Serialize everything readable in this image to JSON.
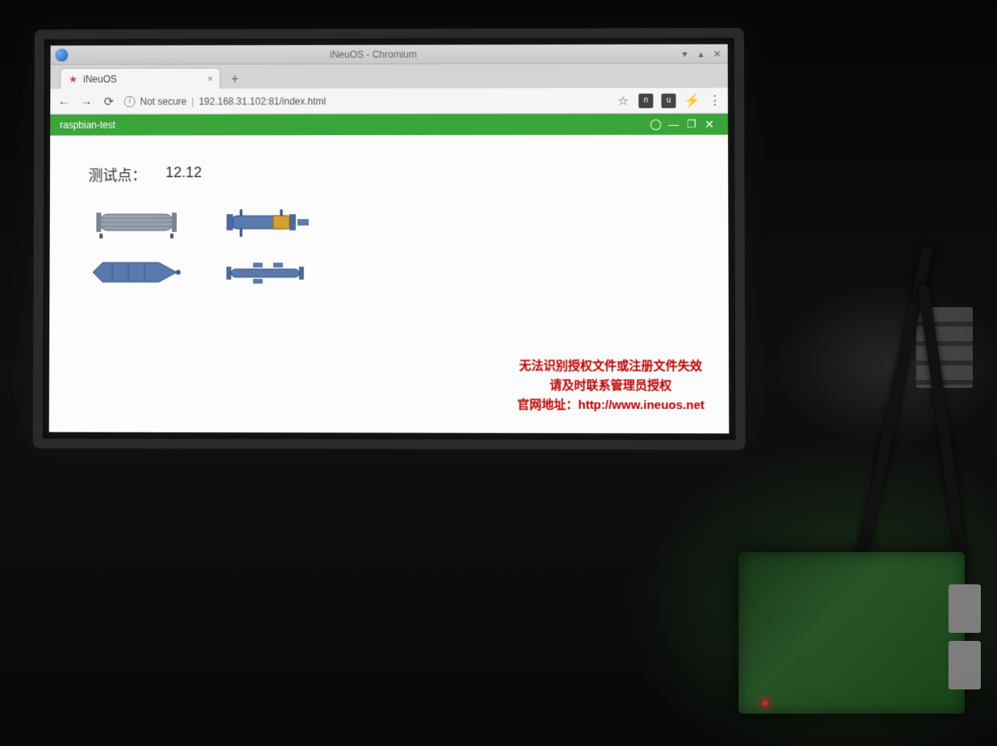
{
  "os_window": {
    "title": "iNeuOS - Chromium"
  },
  "browser": {
    "tab": {
      "label": "iNeuOS"
    },
    "security_label": "Not secure",
    "url": "192.168.31.102:81/index.html"
  },
  "appbar": {
    "title": "raspbian-test"
  },
  "page": {
    "testpoint_label": "测试点：",
    "testpoint_value": "12.12"
  },
  "license": {
    "line1": "无法识别授权文件或注册文件失效",
    "line2": "请及时联系管理员授权",
    "line3_prefix": "官网地址：",
    "line3_url": "http://www.ineuos.net"
  },
  "colors": {
    "appbar_bg": "#3aa63a",
    "error_text": "#c00000",
    "equipment_blue": "#5a7aad",
    "equipment_accent": "#d4a030"
  }
}
